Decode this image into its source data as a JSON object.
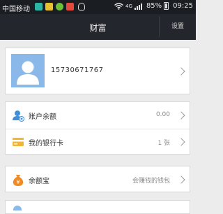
{
  "status_bar": {
    "carrier": "中国移动",
    "signal_label": "4G",
    "battery": "85%",
    "time": "09:25",
    "app_icon_colors": [
      "#2bb3a6",
      "#e7c02f",
      "#6bbf3b",
      "#e24a3b"
    ]
  },
  "header": {
    "title": "财富",
    "settings_label": "设置"
  },
  "profile": {
    "phone": "15730671767"
  },
  "rows": {
    "balance": {
      "label": "账户余额",
      "value": "0.00"
    },
    "bank_card": {
      "label": "我的银行卡",
      "value": "1 张"
    },
    "yuebao": {
      "label": "余额宝",
      "value": "会赚钱的钱包"
    }
  },
  "colors": {
    "header_bg": "#23262c",
    "avatar_bg": "#8ab8e8",
    "balance_icon": "#3e8fd8",
    "card_icon": "#f2b632",
    "yuebao_icon": "#f08a24"
  },
  "icons": [
    "wifi-icon",
    "signal-icon",
    "battery-icon",
    "avatar-icon",
    "wallet-icon",
    "bank-card-icon",
    "money-bag-icon",
    "chevron-right-icon"
  ]
}
